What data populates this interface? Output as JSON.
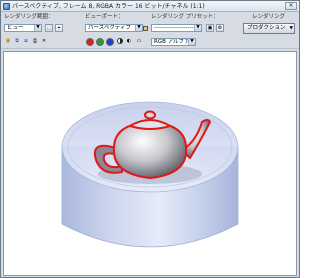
{
  "window": {
    "title": "パースペクティブ, フレーム 8, RGBA カラー 16 ビット/チャネル (1:1)",
    "close_glyph": "✕"
  },
  "toolbar": {
    "render_region_label": "レンダリング範囲：",
    "render_region_value": "ビュー",
    "viewport_label": "ビューポート：",
    "viewport_value": "パースペクティブ",
    "preset_label": "レンダリング プリセット：",
    "preset_value": "--------------------",
    "rendering_label": "レンダリング",
    "production_value": "プロダクション",
    "channel_value": "RGB アルファ",
    "arrow_glyph": "▼"
  },
  "icons": {
    "region_edit": "⬚",
    "region_lock": "⌖",
    "lock": "🔒",
    "save": "▣",
    "settings": "⚙",
    "copy": "⧉",
    "clone": "⧈",
    "print": "⎙",
    "clear": "✕",
    "mono": "◐",
    "channel_box": "▭"
  },
  "colors": {
    "accent": "#d32020",
    "channel_red": "#e02020",
    "channel_green": "#20a030",
    "channel_blue": "#2040d0",
    "alpha": "#ffffff"
  }
}
